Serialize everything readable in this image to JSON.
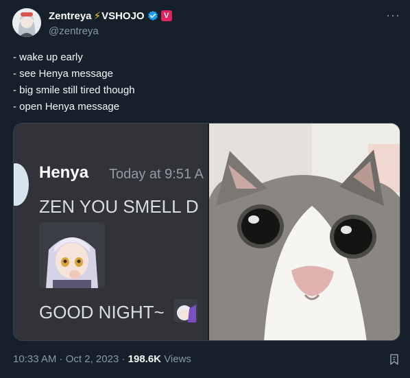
{
  "author": {
    "name": "Zentreya",
    "bolt": "⚡",
    "org": "VSHOJO",
    "vshojo_badge": "V",
    "handle": "@zentreya"
  },
  "menu_glyph": "···",
  "tweet_lines": [
    "- wake up early",
    "- see Henya message",
    "- big smile still tired though",
    "- open Henya message"
  ],
  "media": {
    "discord": {
      "username": "Henya",
      "timestamp": "Today at 9:51 A",
      "message1": "ZEN YOU SMELL D",
      "message2": "GOOD NIGHT~"
    }
  },
  "meta": {
    "time": "10:33 AM",
    "sep1": "·",
    "date": "Oct 2, 2023",
    "sep2": "·",
    "views_count": "198.6K",
    "views_label": "Views"
  },
  "colors": {
    "background": "#15202b",
    "verified_blue": "#1d9bf0",
    "vshojo_pink": "#e0245e",
    "muted": "#8b98a5",
    "discord_bg": "#313338"
  },
  "icons": {
    "verified": "verified-badge-icon",
    "more": "more-icon",
    "bookmark": "bookmark-icon"
  }
}
